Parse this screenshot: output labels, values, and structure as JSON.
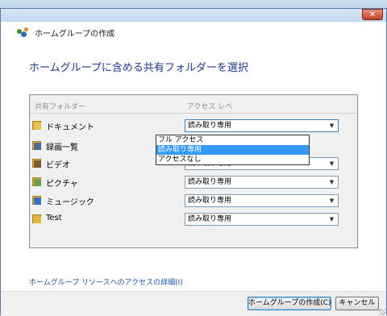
{
  "window": {
    "header_title": "ホームグループの作成",
    "close_label": "✕"
  },
  "main": {
    "heading": "ホームグループに含める共有フォルダーを選択"
  },
  "table": {
    "col_folder": "共有フォルダー",
    "col_access": "アクセス レベ",
    "rows": [
      {
        "name": "ドキュメント",
        "access": "読み取り専用",
        "icon": "documents-folder-icon",
        "color": "#e9c04f"
      },
      {
        "name": "録画一覧",
        "access": "",
        "icon": "recorded-tv-folder-icon",
        "color": "#4a6a95"
      },
      {
        "name": "ビデオ",
        "access": "読み取り専用",
        "icon": "videos-folder-icon",
        "color": "#7d5a2f"
      },
      {
        "name": "ピクチャ",
        "access": "読み取り専用",
        "icon": "pictures-folder-icon",
        "color": "#6aa04a"
      },
      {
        "name": "ミュージック",
        "access": "読み取り専用",
        "icon": "music-folder-icon",
        "color": "#3a6fc0"
      },
      {
        "name": "Test",
        "access": "読み取り専用",
        "icon": "folder-icon",
        "color": "#e1b83f"
      }
    ]
  },
  "dropdown_popup": {
    "options": [
      "フル アクセス",
      "読み取り専用",
      "アクセスなし"
    ],
    "selected_index": 1
  },
  "footer": {
    "details_link": "ホームグループ リソースへのアクセスの詳細(I)",
    "create_button": "ホームグループの作成(C)",
    "cancel_button": "キャンセル"
  },
  "colors": {
    "heading": "#1e3a8a",
    "link": "#1a4f9c",
    "selection": "#3399ff"
  }
}
